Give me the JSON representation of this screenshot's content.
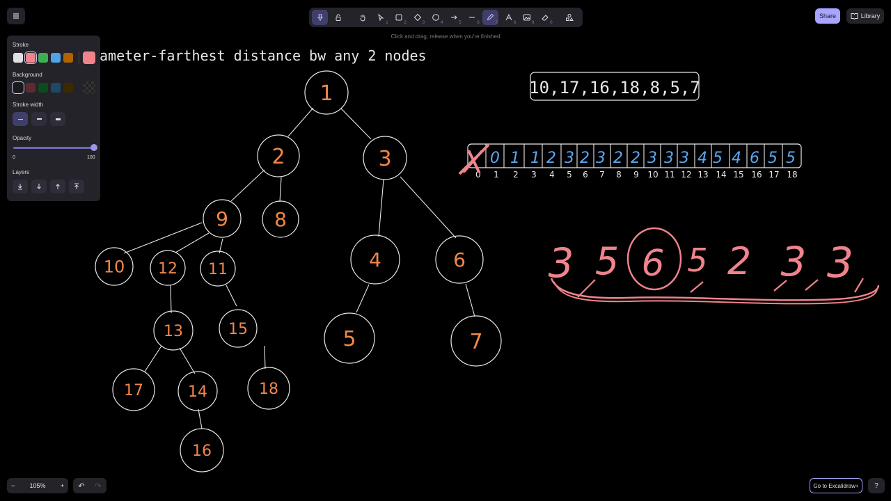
{
  "toolbar": {
    "tools": [
      {
        "name": "lock",
        "key": ""
      },
      {
        "name": "hand",
        "key": ""
      },
      {
        "name": "select",
        "key": "1"
      },
      {
        "name": "rectangle",
        "key": "2"
      },
      {
        "name": "diamond",
        "key": "3"
      },
      {
        "name": "ellipse",
        "key": "4"
      },
      {
        "name": "arrow",
        "key": "5"
      },
      {
        "name": "line",
        "key": "6"
      },
      {
        "name": "draw",
        "key": "7"
      },
      {
        "name": "text",
        "key": "8"
      },
      {
        "name": "image",
        "key": "9"
      },
      {
        "name": "eraser",
        "key": "0"
      },
      {
        "name": "extra-tools",
        "key": ""
      }
    ],
    "hint": "Click and drag, release when you're finished",
    "share_label": "Share",
    "library_label": "Library"
  },
  "panel": {
    "stroke_label": "Stroke",
    "stroke_colors": [
      "#e0e0e0",
      "#f0838c",
      "#3fae56",
      "#4fa3e8",
      "#b36200"
    ],
    "stroke_current": "#f0838c",
    "background_label": "Background",
    "background_colors": [
      "#1a1a1a",
      "#5c2a30",
      "#0f4a1e",
      "#1c4a66",
      "#3b2a00"
    ],
    "stroke_width_label": "Stroke width",
    "opacity_label": "Opacity",
    "opacity_min": "0",
    "opacity_max": "100",
    "opacity_value": 1.0,
    "layers_label": "Layers"
  },
  "canvas": {
    "title": "ameter-farthest distance bw any 2 nodes",
    "sequence_box": "10,17,16,18,8,5,7",
    "tree_nodes": [
      "1",
      "2",
      "3",
      "9",
      "8",
      "4",
      "6",
      "10",
      "12",
      "11",
      "5",
      "7",
      "13",
      "15",
      "17",
      "14",
      "18",
      "16"
    ],
    "array_values": [
      "0",
      "1",
      "1",
      "2",
      "3",
      "2",
      "3",
      "2",
      "2",
      "3",
      "3",
      "3",
      "4",
      "5",
      "4",
      "6",
      "5",
      "5"
    ],
    "array_indices": [
      "0",
      "1",
      "2",
      "3",
      "4",
      "5",
      "6",
      "7",
      "8",
      "9",
      "10",
      "11",
      "12",
      "13",
      "14",
      "15",
      "16",
      "17",
      "18"
    ],
    "crossed_mark": "X",
    "scribble_numbers": [
      "3",
      "5",
      "6",
      "5",
      "2",
      "3",
      "3"
    ]
  },
  "bottom": {
    "zoom_level": "105%",
    "zoom_out": "−",
    "zoom_in": "+",
    "undo": "↶",
    "redo": "↷",
    "excalidraw_plus": "Go to Excalidraw+",
    "help": "?"
  }
}
